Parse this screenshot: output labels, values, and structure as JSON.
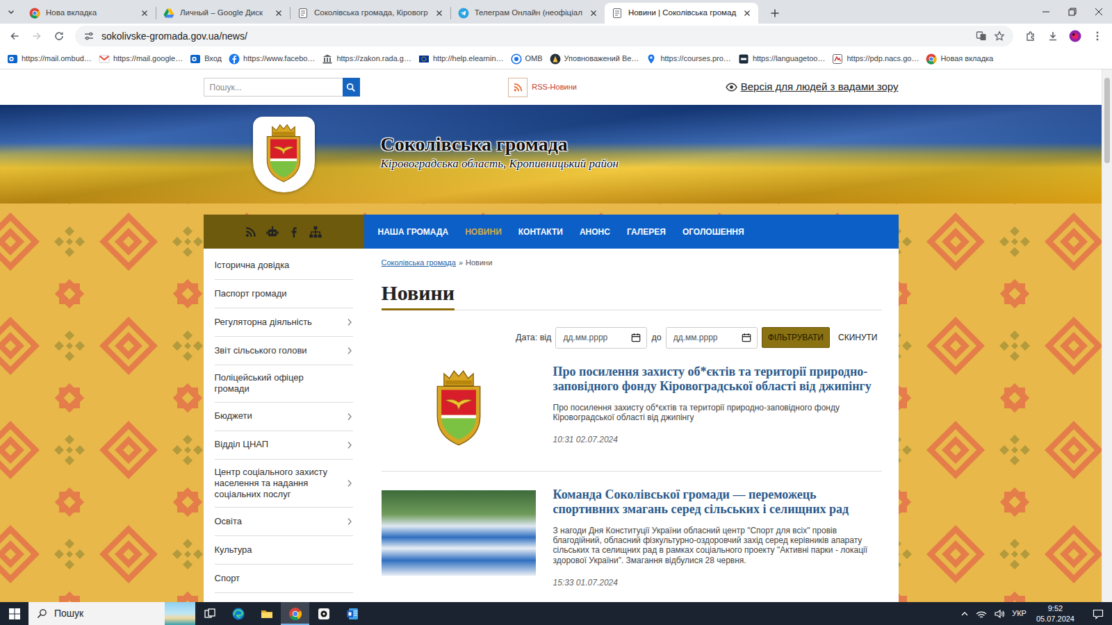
{
  "browser": {
    "tabs": [
      {
        "label": "Нова вкладка",
        "kind": "chrome",
        "selected": false
      },
      {
        "label": "Личный – Google Диск",
        "kind": "drive",
        "selected": false
      },
      {
        "label": "Соколівська громада, Кіровогр",
        "kind": "page",
        "selected": false
      },
      {
        "label": "Телеграм Онлайн (неофіціал",
        "kind": "telegram",
        "selected": false
      },
      {
        "label": "Новини | Соколівська громад",
        "kind": "page",
        "selected": true
      }
    ],
    "can_go_back": true,
    "can_go_forward": false,
    "address": "sokolivske-gromada.gov.ua/news/",
    "bookmarks": [
      {
        "label": "https://mail.ombud…",
        "kind": "outlook"
      },
      {
        "label": "https://mail.google…",
        "kind": "gmail"
      },
      {
        "label": "Вход",
        "kind": "outlook"
      },
      {
        "label": "https://www.facebo…",
        "kind": "facebook"
      },
      {
        "label": "https://zakon.rada.g…",
        "kind": "gov"
      },
      {
        "label": "http://help.elearnin…",
        "kind": "elearning"
      },
      {
        "label": "OMB",
        "kind": "omb"
      },
      {
        "label": "Уповноважений Ве…",
        "kind": "ombudsman"
      },
      {
        "label": "https://courses.pro…",
        "kind": "pin"
      },
      {
        "label": "https://languagetoo…",
        "kind": "lt"
      },
      {
        "label": "https://pdp.nacs.go…",
        "kind": "nacp"
      },
      {
        "label": "Новая вкладка",
        "kind": "chrome"
      }
    ]
  },
  "site": {
    "search": {
      "placeholder": "Пошук..."
    },
    "rss": "RSS-Новини",
    "accessibility": "Версія для людей з вадами зору",
    "title": "Соколівська громада",
    "subtitle": "Кіровоградська область, Кропивницький район",
    "nav": [
      {
        "label": "НАША ГРОМАДА",
        "selected": false
      },
      {
        "label": "НОВИНИ",
        "selected": true
      },
      {
        "label": "КОНТАКТИ",
        "selected": false
      },
      {
        "label": "АНОНС",
        "selected": false
      },
      {
        "label": "ГАЛЕРЕЯ",
        "selected": false
      },
      {
        "label": "ОГОЛОШЕННЯ",
        "selected": false
      }
    ],
    "sidebar": [
      {
        "label": "Історична довідка",
        "expandable": false
      },
      {
        "label": "Паспорт громади",
        "expandable": false
      },
      {
        "label": "Регуляторна діяльність",
        "expandable": true
      },
      {
        "label": "Звіт сільського голови",
        "expandable": true
      },
      {
        "label": "Поліцейський офіцер громади",
        "expandable": false
      },
      {
        "label": "Бюджети",
        "expandable": true
      },
      {
        "label": "Відділ ЦНАП",
        "expandable": true
      },
      {
        "label": "Центр соціального захисту населення та надання соціальних послуг",
        "expandable": true
      },
      {
        "label": "Освіта",
        "expandable": true
      },
      {
        "label": "Культура",
        "expandable": false
      },
      {
        "label": "Спорт",
        "expandable": false
      }
    ],
    "breadcrumb": {
      "home": "Соколівська громада",
      "separator": "»",
      "current": "Новини"
    },
    "heading": "Новини",
    "filter": {
      "from_label": "Дата: від",
      "from_placeholder": "дд.мм.рррр",
      "to_label": "до",
      "to_placeholder": "дд.мм.рррр",
      "apply": "ФІЛЬТРУВАТИ",
      "reset": "СКИНУТИ"
    },
    "news": [
      {
        "kind": "logo",
        "title": "Про посилення захисту об*єктів та території природно-заповідного фонду Кіровоградської області від джипінгу",
        "summary": "Про посилення захисту об*єктів та території природно-заповідного фонду Кіровоградської області від джипінгу",
        "date": "10:31 02.07.2024"
      },
      {
        "kind": "photo",
        "title": "Команда Соколівської громади — переможець спортивних змагань серед сільських і селищних рад",
        "summary": "З нагоди Дня Конституції України обласний центр \"Спорт для всіх\" провів благодійний, обласний фізкультурно-оздоровчий захід серед керівників апарату сільських та селищних рад в рамках соціального проекту \"Активні парки - локації здорової України\". Змагання відбулися 28 червня.",
        "date": "15:33 01.07.2024"
      }
    ]
  },
  "scrollbar": {
    "level": 0.16
  },
  "taskbar": {
    "search": "Пошук",
    "apps": [
      {
        "kind": "taskview",
        "active": false
      },
      {
        "kind": "edge",
        "active": false
      },
      {
        "kind": "explorer",
        "active": false
      },
      {
        "kind": "chrome",
        "active": true
      },
      {
        "kind": "p",
        "active": false
      },
      {
        "kind": "word",
        "active": false
      }
    ],
    "language": "УКР",
    "time": "9:52",
    "date": "05.07.2024"
  }
}
